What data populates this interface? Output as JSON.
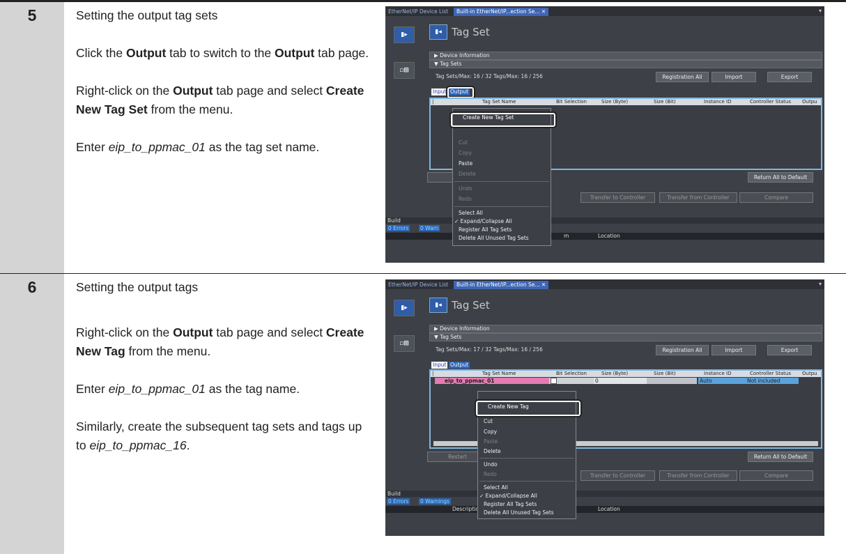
{
  "steps": [
    {
      "number": "5",
      "heading": "Setting the output tag sets",
      "p1": {
        "a": "Click the ",
        "b": "Output",
        "c": " tab to switch to the ",
        "d": "Output",
        "e": " tab page."
      },
      "p2": {
        "a": "Right-click on the ",
        "b": "Output",
        "c": " tab page and select ",
        "d": "Create New Tag Set",
        "e": " from the menu."
      },
      "p3": {
        "a": "Enter ",
        "b": "eip_to_ppmac_01",
        "c": " as the tag set name."
      }
    },
    {
      "number": "6",
      "heading": "Setting the output tags",
      "p1": {
        "a": "Right-click on the ",
        "b": "Output",
        "c": " tab page and select ",
        "d": "Create New Tag",
        "e": " from the menu."
      },
      "p2": {
        "a": "Enter ",
        "b": "eip_to_ppmac_01",
        "c": " as the tag name."
      },
      "p3": {
        "a": "Similarly, create the subsequent tag sets and tags up to ",
        "b": "eip_to_ppmac_16",
        "c": "."
      }
    }
  ],
  "shots": [
    {
      "tab1": "EtherNet/IP Device List",
      "tab2": "Built-in EtherNet/IP...ection Se... ✕",
      "title": "Tag Set",
      "device_info": "▶ Device Information",
      "tag_sets": "▼ Tag Sets",
      "counts": "Tag Sets/Max:  16  /  32     Tags/Max:  16  /  256",
      "btn_reg": "Registration All",
      "btn_import": "Import",
      "btn_export": "Export",
      "sub_input": "Input",
      "sub_output": "Output",
      "headers": [
        "Tag Set Name",
        "Bit Selection",
        "Size (Byte)",
        "Size (Bit)",
        "Instance ID",
        "Controller Status",
        "Outpu"
      ],
      "menu": [
        "Create New Tag Set",
        "Cut",
        "Copy",
        "Paste",
        "Delete",
        "Undo",
        "Redo",
        "Select All",
        "✓ Expand/Collapse All",
        "Register All Tag Sets",
        "Delete All Unused Tag Sets"
      ],
      "btn_restart": "Re",
      "btn_return": "Return All to Default",
      "btn_transfer_to": "Transfer to Controller",
      "btn_transfer_from": "Transfer from Controller",
      "btn_compare": "Compare",
      "build": "Build",
      "errors": "0  Errors",
      "warnings": "0  Warn",
      "col_desc": "D",
      "col_m": "m",
      "col_location": "Location"
    },
    {
      "tab1": "EtherNet/IP Device List",
      "tab2": "Built-in EtherNet/IP...ection Se... ✕",
      "title": "Tag Set",
      "device_info": "▶ Device Information",
      "tag_sets": "▼ Tag Sets",
      "counts": "Tag Sets/Max:  17  /  32     Tags/Max:  16  /  256",
      "btn_reg": "Registration All",
      "btn_import": "Import",
      "btn_export": "Export",
      "sub_input": "Input",
      "sub_output": "Output",
      "headers": [
        "Tag Set Name",
        "Bit Selection",
        "Size (Byte)",
        "Size (Bit)",
        "Instance ID",
        "Controller Status",
        "Outpu"
      ],
      "row": {
        "name": "eip_to_ppmac_01",
        "size": "0",
        "instance": "Auto",
        "status": "Not included"
      },
      "menu": [
        "Create New Tag",
        "Cut",
        "Copy",
        "Paste",
        "Delete",
        "Undo",
        "Redo",
        "Select All",
        "✓ Expand/Collapse All",
        "Register All Tag Sets",
        "Delete All Unused Tag Sets"
      ],
      "btn_restart": "Restart",
      "btn_return": "Return All to Default",
      "btn_transfer_to": "Transfer to Controller",
      "btn_transfer_from": "Transfer from Controller",
      "btn_compare": "Compare",
      "build": "Build",
      "errors": "0  Errors",
      "warnings": "0  Warnings",
      "col_desc": "Descriptio",
      "col_location": "Location"
    }
  ]
}
